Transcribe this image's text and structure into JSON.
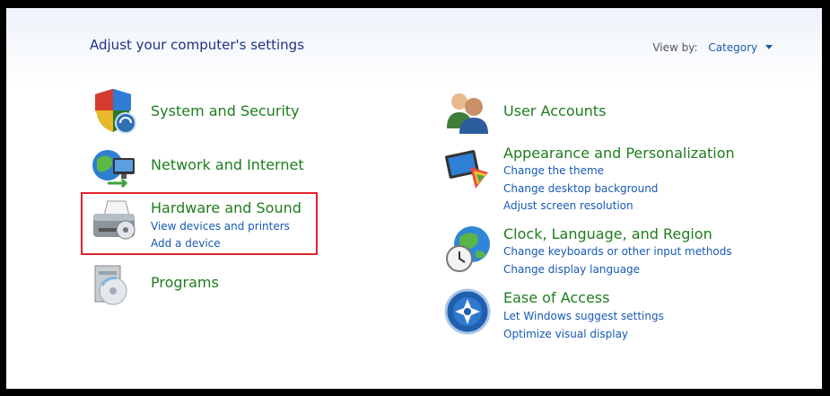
{
  "header": {
    "title": "Adjust your computer's settings",
    "view_by_label": "View by:",
    "view_by_value": "Category"
  },
  "left": {
    "system_security": {
      "title": "System and Security"
    },
    "network": {
      "title": "Network and Internet"
    },
    "hardware": {
      "title": "Hardware and Sound",
      "links": [
        "View devices and printers",
        "Add a device"
      ]
    },
    "programs": {
      "title": "Programs"
    }
  },
  "right": {
    "user_accounts": {
      "title": "User Accounts"
    },
    "appearance": {
      "title": "Appearance and Personalization",
      "links": [
        "Change the theme",
        "Change desktop background",
        "Adjust screen resolution"
      ]
    },
    "clock": {
      "title": "Clock, Language, and Region",
      "links": [
        "Change keyboards or other input methods",
        "Change display language"
      ]
    },
    "ease": {
      "title": "Ease of Access",
      "links": [
        "Let Windows suggest settings",
        "Optimize visual display"
      ]
    }
  },
  "colors": {
    "heading_green": "#1e7d1e",
    "link_blue": "#1659b6",
    "title_blue": "#1e3287",
    "highlight_red": "#e0232b"
  }
}
